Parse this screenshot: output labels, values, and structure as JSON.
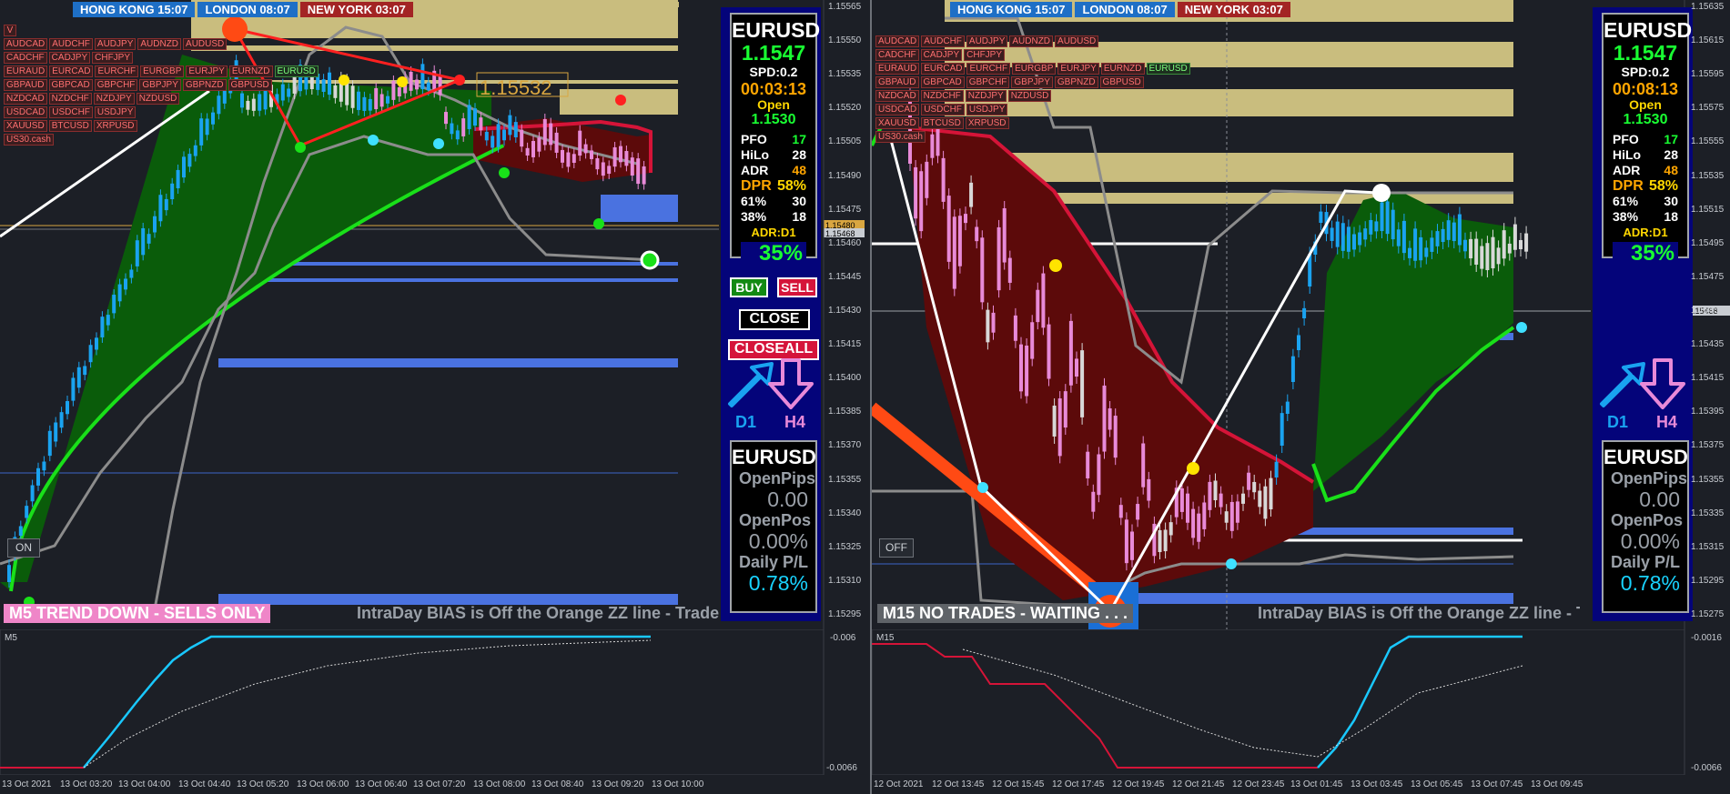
{
  "windows": [
    {
      "id": "left",
      "sessions": [
        {
          "label": "HONG KONG 15:07",
          "style": "blue"
        },
        {
          "label": "LONDON  08:07",
          "style": "blue"
        },
        {
          "label": "NEW YORK  03:07",
          "style": "red"
        }
      ],
      "pairs": [
        [
          "V"
        ],
        [
          "AUDCAD",
          "AUDCHF",
          "AUDJPY",
          "AUDNZD",
          "AUDUSD"
        ],
        [
          "CADCHF",
          "CADJPY",
          "CHFJPY"
        ],
        [
          "EURAUD",
          "EURCAD",
          "EURCHF",
          "EURGBP",
          "EURJPY",
          "EURNZD",
          "EURUSD"
        ],
        [
          "GBPAUD",
          "GBPCAD",
          "GBPCHF",
          "GBPJPY",
          "GBPNZD",
          "GBPUSD"
        ],
        [
          "NZDCAD",
          "NZDCHF",
          "NZDJPY",
          "NZDUSD"
        ],
        [
          "USDCAD",
          "USDCHF",
          "USDJPY"
        ],
        [
          "XAUUSD",
          "BTCUSD",
          "XRPUSD"
        ],
        [
          "US30.cash"
        ]
      ],
      "current_pair": "EURUSD",
      "price_label": "1.15532",
      "price_axis": [
        "1.15565",
        "1.15550",
        "1.15535",
        "1.15520",
        "1.15505",
        "1.15490",
        "1.15475",
        "1.15460",
        "1.15445",
        "1.15430",
        "1.15415",
        "1.15400",
        "1.15385",
        "1.15370",
        "1.15355",
        "1.15340",
        "1.15325",
        "1.15310",
        "1.15295"
      ],
      "price_axis_markers": [
        "1.15480",
        "1.15468"
      ],
      "time_axis": [
        "13 Oct 2021",
        "13 Oct 03:20",
        "13 Oct 04:00",
        "13 Oct 04:40",
        "13 Oct 05:20",
        "13 Oct 06:00",
        "13 Oct 06:40",
        "13 Oct 07:20",
        "13 Oct 08:00",
        "13 Oct 08:40",
        "13 Oct 09:20",
        "13 Oct 10:00"
      ],
      "status": "M5  TREND DOWN - SELLS ONLY",
      "status_style": "pink",
      "ticker": "IntraDay BIAS is Off the Orange ZZ line - Trade th",
      "toggle": "ON",
      "indicator": {
        "label": "M5",
        "axis_top": "-0.006",
        "axis_bottom": "-0.0066"
      },
      "panel": {
        "symbol": "EURUSD",
        "price": "1.1547",
        "spread": "SPD:0.2",
        "timer": "00:03:13",
        "open_label": "Open",
        "open_value": "1.1530",
        "stats": [
          {
            "k": "PFO",
            "v": "17",
            "c": "green"
          },
          {
            "k": "HiLo",
            "v": "28",
            "c": "white"
          },
          {
            "k": "ADR",
            "v": "48",
            "c": "orange"
          }
        ],
        "dpr": {
          "k": "DPR",
          "v": "58%"
        },
        "fibs": [
          {
            "k": "61%",
            "v": "30"
          },
          {
            "k": "38%",
            "v": "18"
          }
        ],
        "adr_label": "ADR:D1",
        "adr_pct": "35%",
        "buttons": {
          "buy": "BUY",
          "sell": "SELL",
          "close": "CLOSE",
          "closeall": "CLOSEALL"
        },
        "tf_up": "D1",
        "tf_down": "H4",
        "pnl": {
          "symbol": "EURUSD",
          "openpips_label": "OpenPips",
          "openpips_value": "0.00",
          "openpos_label": "OpenPos",
          "openpos_value": "0.00%",
          "daily_label": "Daily P/L",
          "daily_value": "0.78%"
        }
      }
    },
    {
      "id": "right",
      "sessions": [
        {
          "label": "HONG KONG 15:07",
          "style": "blue"
        },
        {
          "label": "LONDON  08:07",
          "style": "blue"
        },
        {
          "label": "NEW YORK  03:07",
          "style": "red"
        }
      ],
      "pairs": [
        [
          "AUDCAD",
          "AUDCHF",
          "AUDJPY",
          "AUDNZD",
          "AUDUSD"
        ],
        [
          "CADCHF",
          "CADJPY",
          "CHFJPY"
        ],
        [
          "EURAUD",
          "EURCAD",
          "EURCHF",
          "EURGBP",
          "EURJPY",
          "EURNZD",
          "EURUSD"
        ],
        [
          "GBPAUD",
          "GBPCAD",
          "GBPCHF",
          "GBPJPY",
          "GBPNZD",
          "GBPUSD"
        ],
        [
          "NZDCAD",
          "NZDCHF",
          "NZDJPY",
          "NZDUSD"
        ],
        [
          "USDCAD",
          "USDCHF",
          "USDJPY"
        ],
        [
          "XAUUSD",
          "BTCUSD",
          "XRPUSD"
        ],
        [
          "US30.cash"
        ]
      ],
      "current_pair": "EURUSD",
      "price_axis": [
        "1.15635",
        "1.15615",
        "1.15595",
        "1.15575",
        "1.15555",
        "1.15535",
        "1.15515",
        "1.15495",
        "1.15475",
        "1.15455",
        "1.15435",
        "1.15415",
        "1.15395",
        "1.15375",
        "1.15355",
        "1.15335",
        "1.15315",
        "1.15295",
        "1.15275"
      ],
      "price_axis_markers": [
        "1.15468"
      ],
      "time_axis": [
        "12 Oct 2021",
        "12 Oct 13:45",
        "12 Oct 15:45",
        "12 Oct 17:45",
        "12 Oct 19:45",
        "12 Oct 21:45",
        "12 Oct 23:45",
        "13 Oct 01:45",
        "13 Oct 03:45",
        "13 Oct 05:45",
        "13 Oct 07:45",
        "13 Oct 09:45"
      ],
      "status": "M15  NO TRADES - WAITING . . .",
      "status_style": "grey",
      "ticker": "IntraDay BIAS is Off the Orange ZZ line - Trade th",
      "toggle": "OFF",
      "indicator": {
        "label": "M15",
        "axis_top": "-0.0016",
        "axis_bottom": "-0.0066"
      },
      "panel": {
        "symbol": "EURUSD",
        "price": "1.1547",
        "spread": "SPD:0.2",
        "timer": "00:08:13",
        "open_label": "Open",
        "open_value": "1.1530",
        "stats": [
          {
            "k": "PFO",
            "v": "17",
            "c": "green"
          },
          {
            "k": "HiLo",
            "v": "28",
            "c": "white"
          },
          {
            "k": "ADR",
            "v": "48",
            "c": "orange"
          }
        ],
        "dpr": {
          "k": "DPR",
          "v": "58%"
        },
        "fibs": [
          {
            "k": "61%",
            "v": "30"
          },
          {
            "k": "38%",
            "v": "18"
          }
        ],
        "adr_label": "ADR:D1",
        "adr_pct": "35%",
        "tf_up": "D1",
        "tf_down": "H4",
        "pnl": {
          "symbol": "EURUSD",
          "openpips_label": "OpenPips",
          "openpips_value": "0.00",
          "openpos_label": "OpenPos",
          "openpos_value": "0.00%",
          "daily_label": "Daily P/L",
          "daily_value": "0.78%"
        }
      }
    }
  ],
  "colors": {
    "bull_candle": "#1aa3f0",
    "bear_candle": "#e88ad8",
    "neutral_candle": "#d8d8d8",
    "green_line": "#19e019",
    "red_line": "#d51438",
    "green_fill": "#0a5c0a",
    "red_fill": "#5c0a0a",
    "zone": "#c9bd7e",
    "blue_zone": "#4a72e0",
    "grey_band": "#8c8c8c",
    "orange_zz": "#ff4a14",
    "panel": "#04047a"
  }
}
